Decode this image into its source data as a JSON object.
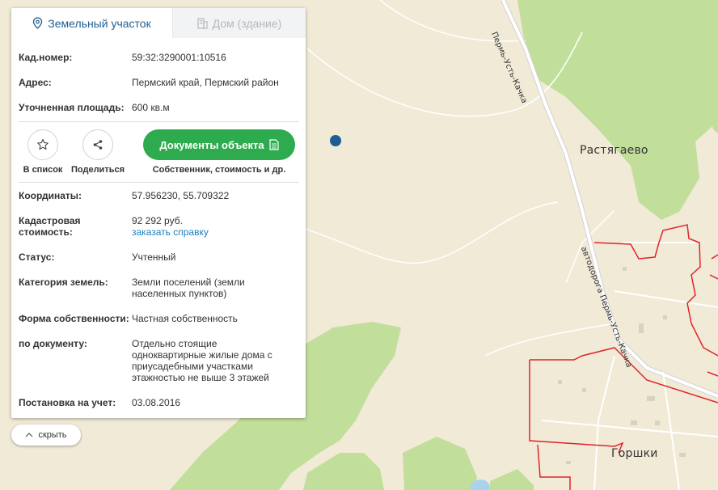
{
  "tabs": {
    "land": "Земельный участок",
    "building": "Дом (здание)"
  },
  "info_top": [
    {
      "label": "Кад.номер:",
      "value": "59:32:3290001:10516",
      "is_link": true
    },
    {
      "label": "Адрес:",
      "value": "Пермский край, Пермский район",
      "is_link": false
    },
    {
      "label": "Уточненная площадь:",
      "value": "600 кв.м",
      "is_link": false
    }
  ],
  "actions": {
    "favorite_label": "В список",
    "share_label": "Поделиться",
    "documents_label": "Документы объекта",
    "documents_sub": "Собственник, стоимость и др."
  },
  "info_bottom": {
    "coords_label": "Координаты:",
    "coords_value": "57.956230, 55.709322",
    "cad_cost_label": "Кадастровая стоимость:",
    "cad_cost_value": "92 292 руб.",
    "cad_cost_link": "заказать справку",
    "status_label": "Статус:",
    "status_value": "Учтенный",
    "category_label": "Категория земель:",
    "category_value": "Земли поселений (земли населенных пунктов)",
    "ownership_label": "Форма собственности:",
    "ownership_value": "Частная собственность",
    "by_doc_label": "по документу:",
    "by_doc_value": "Отдельно стоящие одноквартирные жилые дома с приусадебными участками этажностью не выше 3 этажей",
    "reg_label": "Постановка на учет:",
    "reg_value": "03.08.2016"
  },
  "hide_label": "скрыть",
  "map": {
    "village1": "Растягаево",
    "village2": "Горшки",
    "road_label_1": "Пермь-Усть-Качка",
    "road_label_2": "автодорога Пермь-Усть-Качка",
    "colors": {
      "background": "#f1ead7",
      "forest": "#c2de9b",
      "road": "#ffffff",
      "boundary": "#e0242c",
      "marker": "#1c5f95",
      "water": "#a9d3ec"
    }
  },
  "icons": {
    "land_tab": "map-pin-icon",
    "building_tab": "building-icon",
    "favorite": "star-icon",
    "share": "share-icon",
    "documents": "document-icon",
    "hide": "chevron-up-icon"
  }
}
